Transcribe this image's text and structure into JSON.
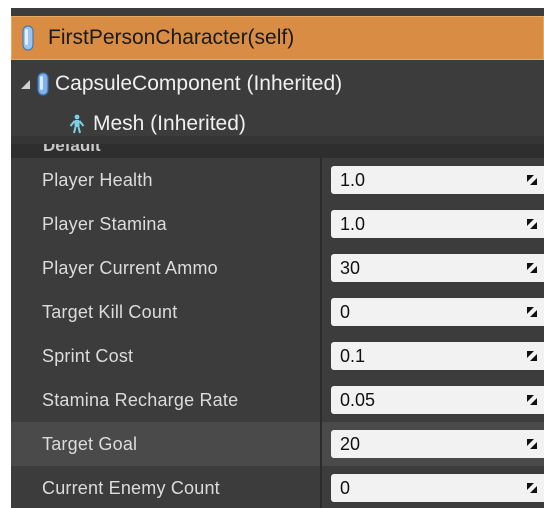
{
  "hierarchy": {
    "root": {
      "label": "FirstPersonCharacter(self)",
      "icon": "capsule-icon"
    },
    "children": [
      {
        "label": "CapsuleComponent (Inherited)",
        "icon": "capsule-icon",
        "expanded": true
      },
      {
        "label": "Mesh (Inherited)",
        "icon": "skeletal-mesh-icon"
      }
    ]
  },
  "details": {
    "category": "Default",
    "properties": [
      {
        "name": "Player Health",
        "value": "1.0"
      },
      {
        "name": "Player Stamina",
        "value": "1.0"
      },
      {
        "name": "Player Current Ammo",
        "value": "30"
      },
      {
        "name": "Target Kill Count",
        "value": "0"
      },
      {
        "name": "Sprint Cost",
        "value": "0.1"
      },
      {
        "name": "Stamina Recharge Rate",
        "value": "0.05"
      },
      {
        "name": "Target Goal",
        "value": "20",
        "hovered": true
      },
      {
        "name": "Current Enemy Count",
        "value": "0"
      }
    ]
  },
  "colors": {
    "selection": "#d98c44",
    "panel": "#3c3c3c",
    "field": "#f2f2f2"
  }
}
